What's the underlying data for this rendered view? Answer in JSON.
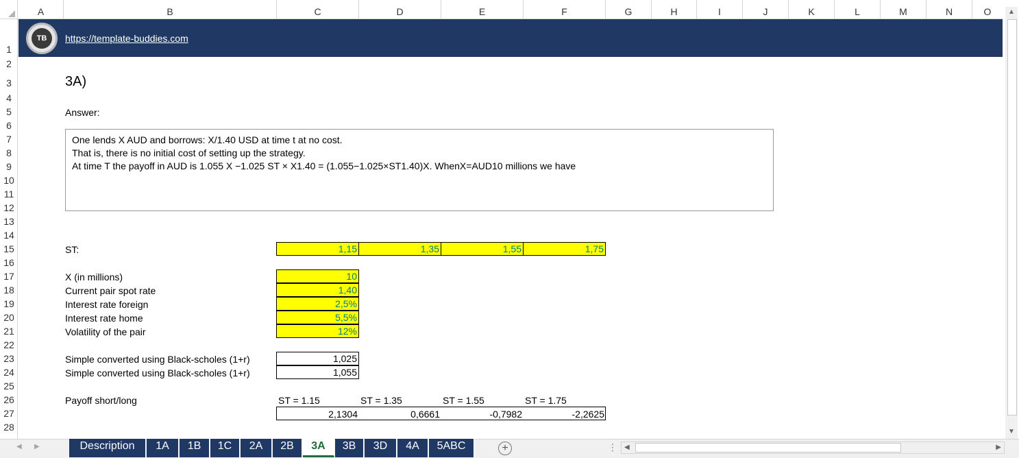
{
  "columns": [
    "A",
    "B",
    "C",
    "D",
    "E",
    "F",
    "G",
    "H",
    "I",
    "J",
    "K",
    "L",
    "M",
    "N",
    "O"
  ],
  "rows": [
    "1",
    "2",
    "3",
    "4",
    "5",
    "6",
    "7",
    "8",
    "9",
    "10",
    "11",
    "12",
    "13",
    "14",
    "15",
    "16",
    "17",
    "18",
    "19",
    "20",
    "21",
    "22",
    "23",
    "24",
    "25",
    "26",
    "27",
    "28"
  ],
  "banner": {
    "logo_text": "TB",
    "link": "https://template-buddies.com",
    "color": "#1f3864"
  },
  "title": "3A)",
  "answer_label": "Answer:",
  "answer_lines": [
    "One lends X AUD and borrows: X/1.40 USD at time t at no cost.",
    "That is, there is no initial cost of setting up the strategy.",
    "At time T the payoff in AUD is 1.055 X −1.025 ST × X1.40 = (1.055−1.025×ST1.40)X. WhenX=AUD10 millions we have"
  ],
  "st": {
    "label": "ST:",
    "values": [
      "1,15",
      "1,35",
      "1,55",
      "1,75"
    ]
  },
  "inputs": [
    {
      "label": "X (in millions)",
      "value": "10"
    },
    {
      "label": "Current pair spot rate",
      "value": "1,40"
    },
    {
      "label": "Interest rate foreign",
      "value": "2,5%"
    },
    {
      "label": "Interest rate home",
      "value": "5,5%"
    },
    {
      "label": "Volatility of the pair",
      "value": "12%"
    }
  ],
  "simple": [
    {
      "label": "Simple converted using Black-scholes (1+r)",
      "value": "1,025"
    },
    {
      "label": "Simple converted using Black-scholes (1+r)",
      "value": "1,055"
    }
  ],
  "payoff": {
    "label": "Payoff short/long",
    "headers": [
      "ST = 1.15",
      "ST = 1.35",
      "ST = 1.55",
      "ST = 1.75"
    ],
    "values": [
      "2,1304",
      "0,6661",
      "-0,7982",
      "-2,2625"
    ]
  },
  "tabs": [
    "Description",
    "1A",
    "1B",
    "1C",
    "2A",
    "2B",
    "3A",
    "3B",
    "3D",
    "4A",
    "5ABC"
  ],
  "active_tab": "3A",
  "colors": {
    "input_fill": "#ffff00",
    "input_text": "#008080",
    "tab_fill": "#1f3864"
  }
}
